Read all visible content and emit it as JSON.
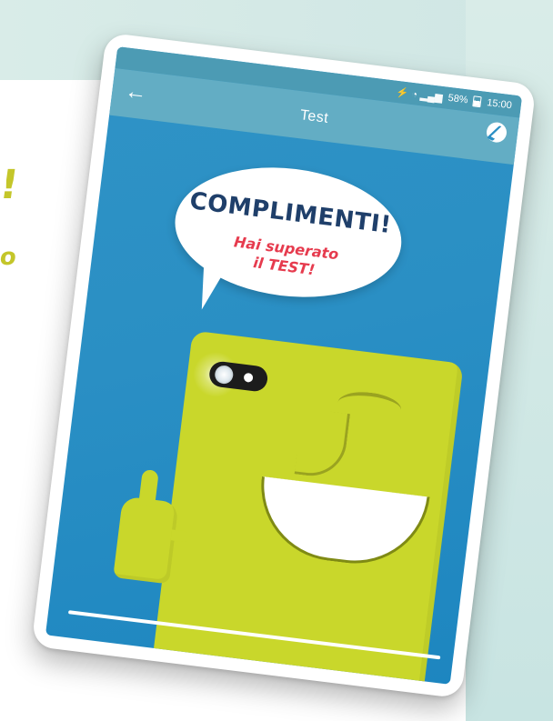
{
  "page": {
    "accent_large": "!",
    "accent_small": "o"
  },
  "status_bar": {
    "battery_percent": "58%",
    "time": "15:00",
    "signal_glyphs": "📶"
  },
  "app_bar": {
    "back_icon": "arrow-left-icon",
    "title": "Test",
    "action_icon": "info-badge-icon"
  },
  "speech_bubble": {
    "headline": "COMPLIMENTI!",
    "line1": "Hai superato",
    "line2": "il TEST!"
  },
  "colors": {
    "screen_bg": "#2b8fc4",
    "app_bar": "#63adc4",
    "character": "#c9d72b",
    "headline": "#1f3f6a",
    "subtext": "#e63b4e"
  }
}
